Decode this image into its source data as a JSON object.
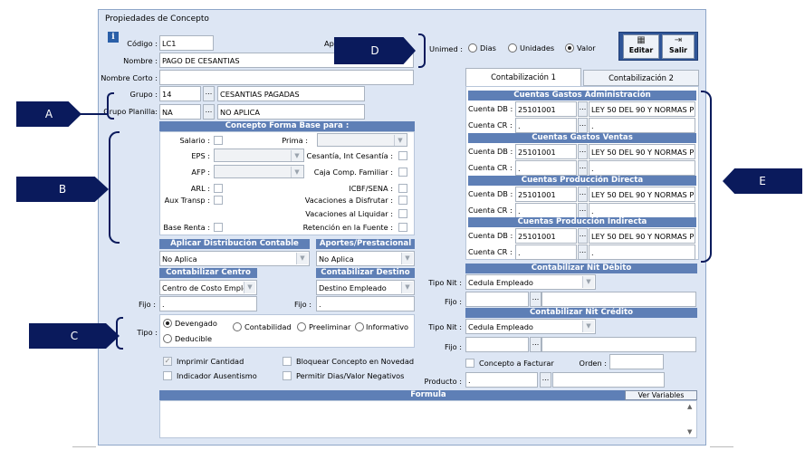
{
  "window": {
    "title": "Propiedades de Concepto"
  },
  "info_icon": "info-icon",
  "fields": {
    "codigo": {
      "label": "Código :",
      "value": "LC1"
    },
    "ap_label": "Ap",
    "nombre": {
      "label": "Nombre :",
      "value": "PAGO DE CESANTIAS"
    },
    "nombre_corto": {
      "label": "Nombre Corto :",
      "value": ""
    },
    "grupo": {
      "label": "Grupo :",
      "code": "14",
      "desc": "CESANTIAS PAGADAS"
    },
    "grupo_planilla": {
      "label": "Grupo Planilla:",
      "code": "NA",
      "desc": "NO APLICA"
    },
    "dots": "..."
  },
  "unimed": {
    "label": "Unimed :",
    "options": [
      "Dias",
      "Unidades",
      "Valor"
    ],
    "selected": "Valor"
  },
  "toolbar": {
    "edit_label": "Editar",
    "exit_label": "Salir"
  },
  "base": {
    "title": "Concepto Forma Base para :",
    "salario": "Salario :",
    "prima": "Prima :",
    "eps": "EPS :",
    "cesantia": "Cesantía, Int Cesantía :",
    "afp": "AFP :",
    "caja": "Caja Comp. Familiar :",
    "arl": "ARL :",
    "icbf": "ICBF/SENA :",
    "aux": "Aux Transp :",
    "vac_disfrutar": "Vacaciones a Disfrutar :",
    "vac_liquidar": "Vacaciones al Liquidar :",
    "base_renta": "Base Renta :",
    "retencion": "Retención en la Fuente :"
  },
  "distribucion": {
    "title": "Aplicar Distribución Contable",
    "value": "No Aplica"
  },
  "aportes": {
    "title": "Aportes/Prestacional",
    "value": "No Aplica"
  },
  "centro": {
    "title": "Contabilizar Centro",
    "value": "Centro de Costo Emple",
    "fijo_label": "Fijo :",
    "fijo_value": "."
  },
  "destino": {
    "title": "Contabilizar Destino",
    "value": "Destino Empleado",
    "fijo_label": "Fijo :",
    "fijo_value": "."
  },
  "tipo": {
    "label": "Tipo :",
    "options": [
      "Devengado",
      "Contabilidad",
      "Preeliminar",
      "Informativo",
      "Deducible"
    ],
    "selected": "Devengado"
  },
  "flags": {
    "imprimir": "Imprimir Cantidad",
    "bloquear": "Bloquear Concepto en Novedad",
    "ausentismo": "Indicador Ausentismo",
    "permitir": "Permitir Dias/Valor Negativos"
  },
  "formula": {
    "title": "Formula",
    "ver_variables": "Ver Variables"
  },
  "tabs": [
    "Contabilización 1",
    "Contabilización 2"
  ],
  "cuentas": [
    {
      "title": "Cuentas Gastos Administración",
      "db_label": "Cuenta DB :",
      "db": "25101001",
      "db_desc": "LEY 50 DEL 90  Y NORMAS P",
      "cr_label": "Cuenta CR :",
      "cr": ".",
      "cr_desc": "."
    },
    {
      "title": "Cuentas Gastos Ventas",
      "db_label": "Cuenta DB :",
      "db": "25101001",
      "db_desc": "LEY 50 DEL 90  Y NORMAS P",
      "cr_label": "Cuenta CR :",
      "cr": ".",
      "cr_desc": "."
    },
    {
      "title": "Cuentas Producción Directa",
      "db_label": "Cuenta DB :",
      "db": "25101001",
      "db_desc": "LEY 50 DEL 90  Y NORMAS P",
      "cr_label": "Cuenta CR :",
      "cr": ".",
      "cr_desc": "."
    },
    {
      "title": "Cuentas Producción Indirecta",
      "db_label": "Cuenta DB :",
      "db": "25101001",
      "db_desc": "LEY 50 DEL 90  Y NORMAS P",
      "cr_label": "Cuenta CR :",
      "cr": ".",
      "cr_desc": "."
    }
  ],
  "nit_debito": {
    "title": "Contabilizar Nit Débito",
    "tipo_label": "Tipo Nit :",
    "tipo_value": "Cedula Empleado",
    "fijo_label": "Fijo :"
  },
  "nit_credito": {
    "title": "Contabilizar Nit Crédito",
    "tipo_label": "Tipo Nit :",
    "tipo_value": "Cedula Empleado",
    "fijo_label": "Fijo :"
  },
  "facturar": {
    "label": "Concepto a Facturar",
    "orden_label": "Orden :"
  },
  "producto": {
    "label": "Producto :",
    "value": "."
  },
  "callouts": [
    "A",
    "B",
    "C",
    "D",
    "E"
  ],
  "colors": {
    "callout": "#0a1a5c",
    "header": "#5e7fb6",
    "window": "#dde6f4"
  }
}
